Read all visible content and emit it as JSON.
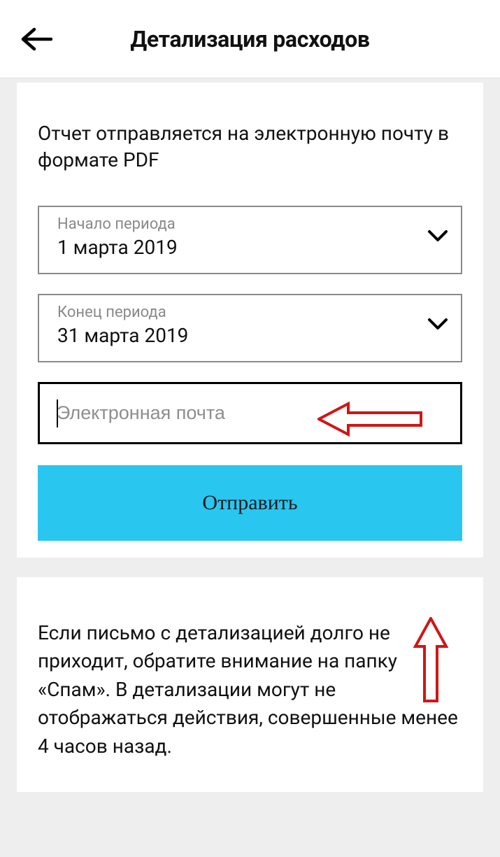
{
  "header": {
    "title": "Детализация расходов"
  },
  "form": {
    "lead": "Отчет отправляется на электронную почту в формате PDF",
    "period_start": {
      "label": "Начало периода",
      "value": "1 марта 2019"
    },
    "period_end": {
      "label": "Конец периода",
      "value": "31 марта 2019"
    },
    "email": {
      "placeholder": "Электронная почта",
      "value": ""
    },
    "submit_label": "Отправить"
  },
  "info": {
    "text": "Если письмо с детализацией долго не приходит, обратите внимание на папку «Спам». В детализации могут не отображаться действия, совершенные менее 4 часов назад."
  },
  "colors": {
    "accent": "#29c6f0",
    "annotation": "#d01616"
  }
}
